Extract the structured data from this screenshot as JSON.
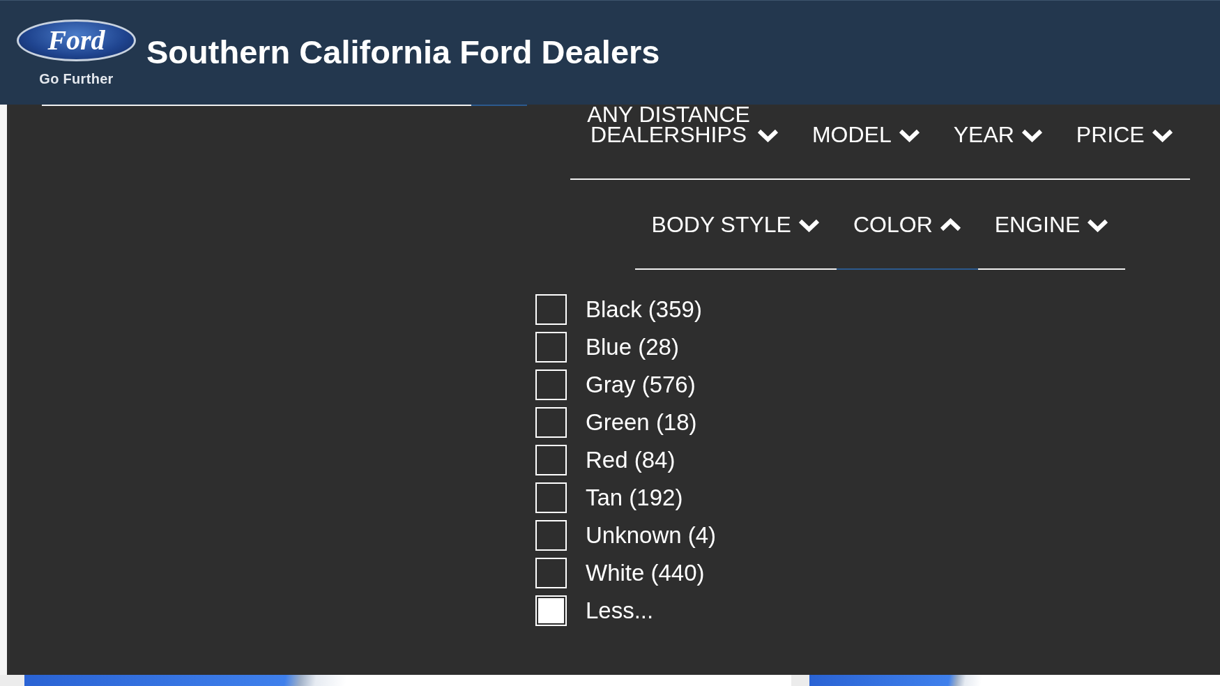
{
  "header": {
    "logo_text": "Ford",
    "tagline": "Go Further",
    "title": "Southern California Ford Dealers"
  },
  "filter_rows": [
    {
      "tabs": [
        {
          "overline": "ANY DISTANCE",
          "label": "DEALERSHIPS",
          "selected": false,
          "expanded": false
        },
        {
          "label": "MODEL",
          "selected": false,
          "expanded": false
        },
        {
          "label": "YEAR",
          "selected": false,
          "expanded": false
        },
        {
          "label": "PRICE",
          "selected": false,
          "expanded": false
        }
      ]
    },
    {
      "tabs": [
        {
          "label": "BODY STYLE",
          "selected": false,
          "expanded": false
        },
        {
          "label": "COLOR",
          "selected": true,
          "expanded": true
        },
        {
          "label": "ENGINE",
          "selected": false,
          "expanded": false
        }
      ]
    }
  ],
  "color_options": [
    {
      "label": "Black (359)",
      "checked": false
    },
    {
      "label": "Blue (28)",
      "checked": false
    },
    {
      "label": "Gray (576)",
      "checked": false
    },
    {
      "label": "Green (18)",
      "checked": false
    },
    {
      "label": "Red (84)",
      "checked": false
    },
    {
      "label": "Tan (192)",
      "checked": false
    },
    {
      "label": "Unknown (4)",
      "checked": false
    },
    {
      "label": "White (440)",
      "checked": false
    },
    {
      "label": "Less...",
      "checked": true
    }
  ]
}
